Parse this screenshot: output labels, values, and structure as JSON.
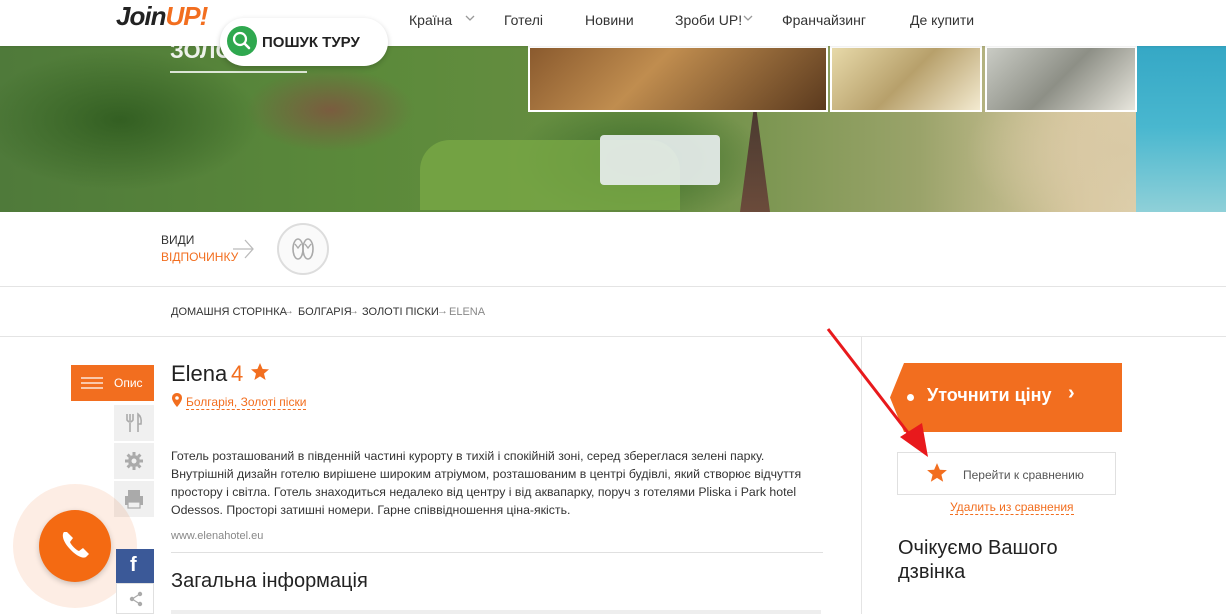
{
  "header": {
    "logo_main": "Join",
    "logo_accent": "UP!",
    "nav": [
      {
        "label": "Країна",
        "has_dropdown": true
      },
      {
        "label": "Готелі",
        "has_dropdown": false
      },
      {
        "label": "Новини",
        "has_dropdown": false
      },
      {
        "label": "Зроби UP!",
        "has_dropdown": true
      },
      {
        "label": "Франчайзинг",
        "has_dropdown": false
      },
      {
        "label": "Де купити",
        "has_dropdown": false
      }
    ],
    "search_label": "ПОШУК ТУРУ"
  },
  "hero": {
    "title_partial": "ЗОЛО"
  },
  "activity": {
    "line1": "ВИДИ",
    "line2": "ВІДПОЧИНКУ",
    "icon": "flip-flops-icon"
  },
  "breadcrumb": [
    "ДОМАШНЯ СТОРІНКА",
    "БОЛГАРІЯ",
    "ЗОЛОТІ ПІСКИ",
    "ELENA"
  ],
  "tabs": {
    "active_label": "Опис"
  },
  "hotel": {
    "name": "Elena",
    "stars": "4",
    "location": "Болгарія, Золоті піски",
    "description": "Готель розташований в південній частині курорту в тихій і спокійній зоні, серед збереглася зелені парку. Внутрішній дизайн готелю вирішене широким атріумом, розташованим в центрі будівлі, який створює відчуття простору і світла. Готель знаходиться недалеко від центру і від аквапарку, поруч з готелями Pliska i Park hotel Odessos. Просторі затишні номери. Гарне співвідношення ціна-якість.",
    "website": "www.elenahotel.eu",
    "section_title": "Загальна інформація"
  },
  "sidebar": {
    "price_button": "Уточнити ціну",
    "compare_button": "Перейти к сравнению",
    "remove_link": "Удалить из сравнения",
    "callback_title": "Очікуємо Вашого дзвінка"
  },
  "social": {
    "facebook": "f"
  },
  "colors": {
    "accent": "#f26e1f",
    "green": "#2fa84f",
    "facebook": "#3b5998"
  }
}
